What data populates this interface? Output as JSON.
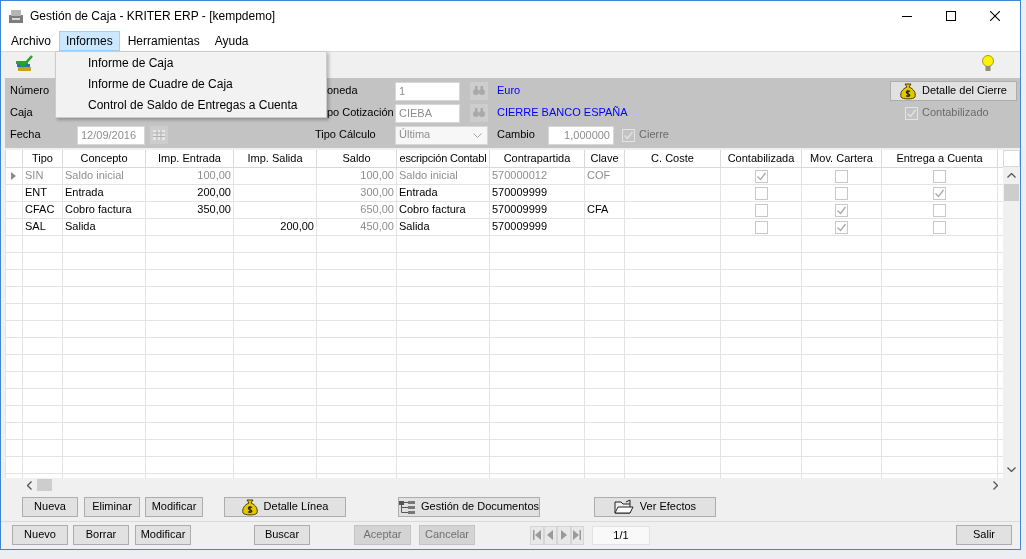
{
  "window": {
    "title": "Gestión de Caja - KRITER ERP - [kempdemo]"
  },
  "menu": [
    {
      "label": "Archivo",
      "selected": false
    },
    {
      "label": "Informes",
      "selected": true
    },
    {
      "label": "Herramientas",
      "selected": false
    },
    {
      "label": "Ayuda",
      "selected": false
    }
  ],
  "open_menu": {
    "items": [
      {
        "label": "Informe de Caja"
      },
      {
        "label": "Informe de Cuadre de Caja"
      },
      {
        "label": "Control de Saldo de Entregas a Cuenta"
      }
    ]
  },
  "header": {
    "left_fields": [
      {
        "label": "Número",
        "kind": "label"
      },
      {
        "label": "Caja",
        "kind": "label"
      },
      {
        "label": "Fecha",
        "kind": "date",
        "value": "12/09/2016",
        "disabled": true
      }
    ],
    "middle_fields": [
      {
        "label": "oneda",
        "kind": "lookup",
        "value": "1",
        "disabled": true,
        "description": "Euro"
      },
      {
        "label": "po Cotización",
        "kind": "lookup",
        "value": "CIEBA",
        "disabled": true,
        "description": "CIERRE BANCO ESPAÑA"
      },
      {
        "label": "Tipo Cálculo",
        "kind": "select",
        "value": "Última",
        "disabled": true
      }
    ],
    "rate_field": {
      "label": "Cambio",
      "value": "1,000000",
      "disabled": true
    },
    "cierre_checkbox": {
      "label": "Cierre",
      "checked": true,
      "disabled": true
    },
    "detail_button": {
      "label": "Detalle del Cierre"
    },
    "contabilizado_checkbox": {
      "label": "Contabilizado",
      "checked": true,
      "disabled": true
    }
  },
  "table": {
    "columns": [
      {
        "label": "Tipo",
        "kind": "text"
      },
      {
        "label": "Concepto",
        "kind": "text"
      },
      {
        "label": "Imp. Entrada",
        "kind": "number"
      },
      {
        "label": "Imp. Salida",
        "kind": "number"
      },
      {
        "label": "Saldo",
        "kind": "computed"
      },
      {
        "label": "escripción Contabl",
        "kind": "text"
      },
      {
        "label": "Contrapartida",
        "kind": "text"
      },
      {
        "label": "Clave",
        "kind": "text"
      },
      {
        "label": "C. Coste",
        "kind": "text"
      },
      {
        "label": "Contabilizada",
        "kind": "check"
      },
      {
        "label": "Mov. Cartera",
        "kind": "check"
      },
      {
        "label": "Entrega a Cuenta",
        "kind": "check"
      }
    ],
    "rows": [
      {
        "selected": true,
        "disabled": true,
        "cells": [
          "SIN",
          "Saldo inicial",
          "100,00",
          null,
          "100,00",
          "Saldo inicial",
          "570000012",
          "COF",
          null,
          {
            "checked": true
          },
          {
            "checked": false
          },
          {
            "checked": false
          }
        ]
      },
      {
        "selected": false,
        "disabled": false,
        "cells": [
          "ENT",
          "Entrada",
          "200,00",
          null,
          "300,00",
          "Entrada",
          "570009999",
          null,
          null,
          {
            "checked": false
          },
          {
            "checked": false
          },
          {
            "checked": true
          }
        ]
      },
      {
        "selected": false,
        "disabled": false,
        "cells": [
          "CFAC",
          "Cobro factura",
          "350,00",
          null,
          "650,00",
          "Cobro factura",
          "570009999",
          "CFA",
          null,
          {
            "checked": false
          },
          {
            "checked": true
          },
          {
            "checked": false
          }
        ]
      },
      {
        "selected": false,
        "disabled": false,
        "cells": [
          "SAL",
          "Salida",
          null,
          "200,00",
          "450,00",
          "Salida",
          "570009999",
          null,
          null,
          {
            "checked": false
          },
          {
            "checked": true
          },
          {
            "checked": false
          }
        ]
      }
    ]
  },
  "line_buttons": [
    {
      "label": "Nueva",
      "kind": "plain"
    },
    {
      "label": "Eliminar",
      "kind": "plain"
    },
    {
      "label": "Modificar",
      "kind": "plain"
    },
    {
      "label": "Detalle Línea",
      "kind": "detail"
    },
    {
      "label": "Gestión de Documentos",
      "kind": "documents"
    },
    {
      "label": "Ver Efectos",
      "kind": "effects"
    }
  ],
  "record_buttons": [
    {
      "label": "Nuevo",
      "disabled": false
    },
    {
      "label": "Borrar",
      "disabled": false
    },
    {
      "label": "Modificar",
      "disabled": false
    },
    {
      "label": "Buscar",
      "disabled": false
    },
    {
      "label": "Aceptar",
      "disabled": true
    },
    {
      "label": "Cancelar",
      "disabled": true
    }
  ],
  "pager": {
    "position": "1/1",
    "disabled": true
  },
  "exit_button": {
    "label": "Salir"
  }
}
